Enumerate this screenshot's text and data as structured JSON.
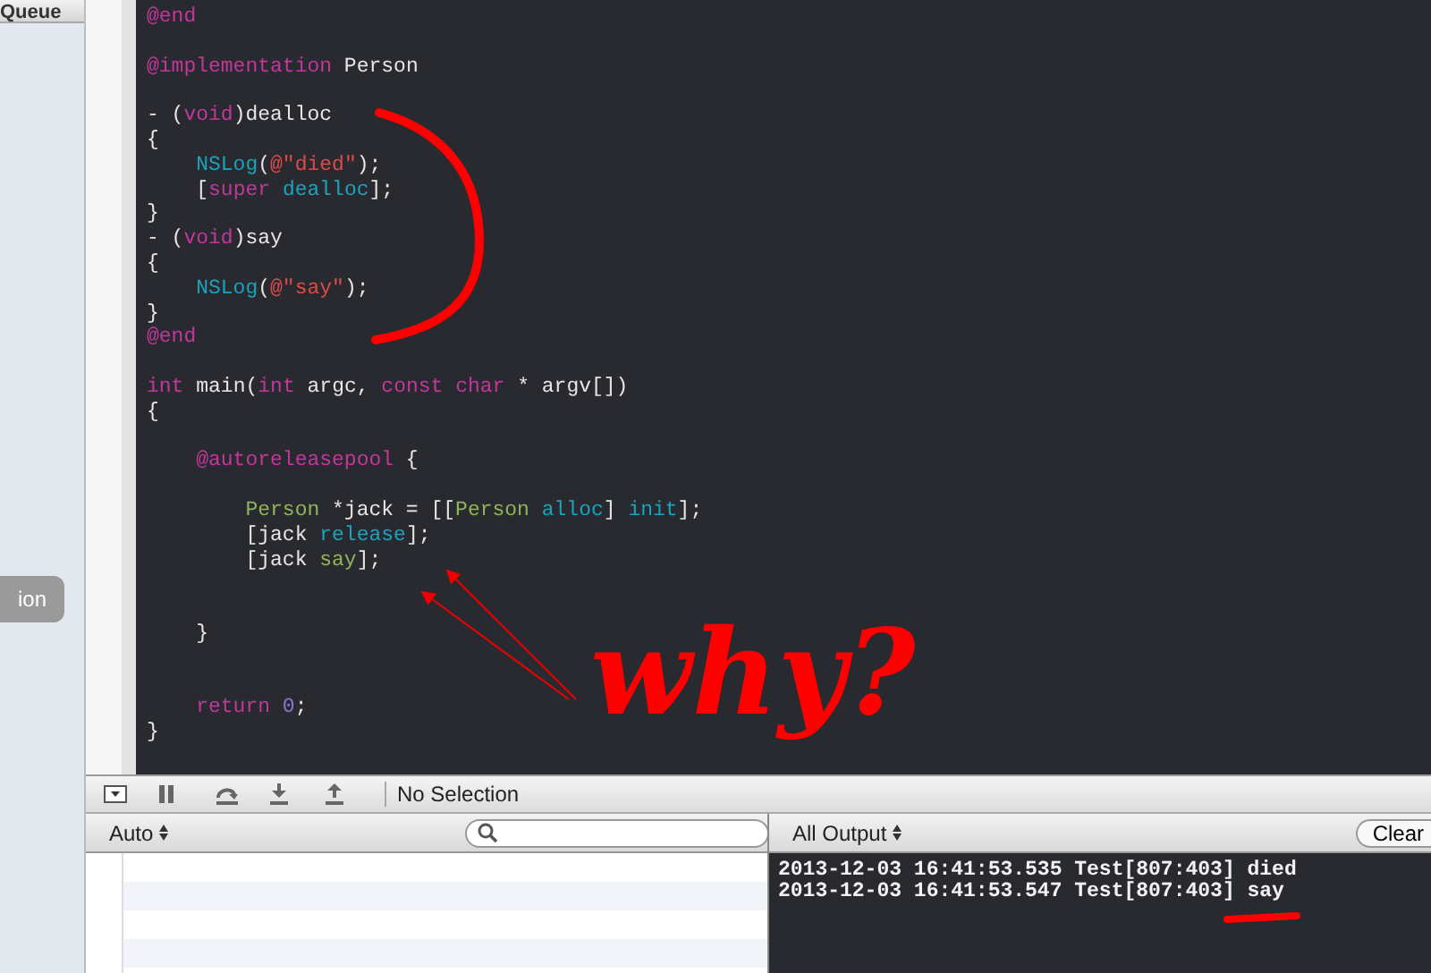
{
  "sidebar": {
    "header": "Queue",
    "button": "ion"
  },
  "editor": {
    "lines": [
      {
        "kind": "code",
        "tokens": [
          {
            "kind": "keyword",
            "text": "@end"
          }
        ]
      },
      {
        "kind": "blank"
      },
      {
        "kind": "code",
        "tokens": [
          {
            "kind": "keyword",
            "text": "@implementation"
          },
          {
            "kind": "plain",
            "text": " Person"
          }
        ]
      },
      {
        "kind": "blank"
      },
      {
        "kind": "code",
        "tokens": [
          {
            "kind": "plain",
            "text": "- ("
          },
          {
            "kind": "keyword",
            "text": "void"
          },
          {
            "kind": "plain",
            "text": ")dealloc"
          }
        ]
      },
      {
        "kind": "code",
        "tokens": [
          {
            "kind": "plain",
            "text": "{"
          }
        ]
      },
      {
        "kind": "code",
        "tokens": [
          {
            "kind": "call",
            "text": "    NSLog"
          },
          {
            "kind": "plain",
            "text": "("
          },
          {
            "kind": "string",
            "text": "@\"died\""
          },
          {
            "kind": "plain",
            "text": ");"
          }
        ]
      },
      {
        "kind": "code",
        "tokens": [
          {
            "kind": "plain",
            "text": "    ["
          },
          {
            "kind": "keyword",
            "text": "super "
          },
          {
            "kind": "call",
            "text": "dealloc"
          },
          {
            "kind": "plain",
            "text": "];"
          }
        ]
      },
      {
        "kind": "code",
        "tokens": [
          {
            "kind": "plain",
            "text": "}"
          }
        ]
      },
      {
        "kind": "code",
        "tokens": [
          {
            "kind": "plain",
            "text": "- ("
          },
          {
            "kind": "keyword",
            "text": "void"
          },
          {
            "kind": "plain",
            "text": ")say"
          }
        ]
      },
      {
        "kind": "code",
        "tokens": [
          {
            "kind": "plain",
            "text": "{"
          }
        ]
      },
      {
        "kind": "code",
        "tokens": [
          {
            "kind": "call",
            "text": "    NSLog"
          },
          {
            "kind": "plain",
            "text": "("
          },
          {
            "kind": "string",
            "text": "@\"say\""
          },
          {
            "kind": "plain",
            "text": ");"
          }
        ]
      },
      {
        "kind": "code",
        "tokens": [
          {
            "kind": "plain",
            "text": "}"
          }
        ]
      },
      {
        "kind": "code",
        "tokens": [
          {
            "kind": "keyword",
            "text": "@end"
          }
        ]
      },
      {
        "kind": "blank"
      },
      {
        "kind": "code",
        "tokens": [
          {
            "kind": "keyword",
            "text": "int"
          },
          {
            "kind": "plain",
            "text": " main("
          },
          {
            "kind": "keyword",
            "text": "int"
          },
          {
            "kind": "plain",
            "text": " argc, "
          },
          {
            "kind": "keyword",
            "text": "const char"
          },
          {
            "kind": "plain",
            "text": " * argv[])"
          }
        ]
      },
      {
        "kind": "code",
        "tokens": [
          {
            "kind": "plain",
            "text": "{"
          }
        ]
      },
      {
        "kind": "blank"
      },
      {
        "kind": "code",
        "tokens": [
          {
            "kind": "keyword",
            "text": "    @autoreleasepool"
          },
          {
            "kind": "plain",
            "text": " {"
          }
        ]
      },
      {
        "kind": "blank"
      },
      {
        "kind": "code",
        "tokens": [
          {
            "kind": "class",
            "text": "        Person"
          },
          {
            "kind": "plain",
            "text": " *jack = [["
          },
          {
            "kind": "class",
            "text": "Person "
          },
          {
            "kind": "call",
            "text": "alloc"
          },
          {
            "kind": "plain",
            "text": "] "
          },
          {
            "kind": "call",
            "text": "init"
          },
          {
            "kind": "plain",
            "text": "];"
          }
        ]
      },
      {
        "kind": "code",
        "tokens": [
          {
            "kind": "plain",
            "text": "        [jack "
          },
          {
            "kind": "call",
            "text": "release"
          },
          {
            "kind": "plain",
            "text": "];"
          }
        ]
      },
      {
        "kind": "code",
        "tokens": [
          {
            "kind": "plain",
            "text": "        [jack "
          },
          {
            "kind": "class",
            "text": "say"
          },
          {
            "kind": "plain",
            "text": "];"
          }
        ]
      },
      {
        "kind": "blank"
      },
      {
        "kind": "blank"
      },
      {
        "kind": "code",
        "tokens": [
          {
            "kind": "plain",
            "text": "    }"
          }
        ]
      },
      {
        "kind": "blank"
      },
      {
        "kind": "blank"
      },
      {
        "kind": "code",
        "tokens": [
          {
            "kind": "keyword",
            "text": "    return "
          },
          {
            "kind": "number",
            "text": "0"
          },
          {
            "kind": "plain",
            "text": ";"
          }
        ]
      },
      {
        "kind": "code",
        "tokens": [
          {
            "kind": "plain",
            "text": "}"
          }
        ]
      }
    ]
  },
  "annotation": {
    "handwriting": "why?"
  },
  "debug_bar": {
    "label": "No Selection"
  },
  "variables": {
    "scope": "Auto"
  },
  "console": {
    "filter": "All Output",
    "clear_button": "Clear",
    "lines": [
      "2013-12-03 16:41:53.535 Test[807:403] died",
      "2013-12-03 16:41:53.547 Test[807:403] say"
    ]
  }
}
